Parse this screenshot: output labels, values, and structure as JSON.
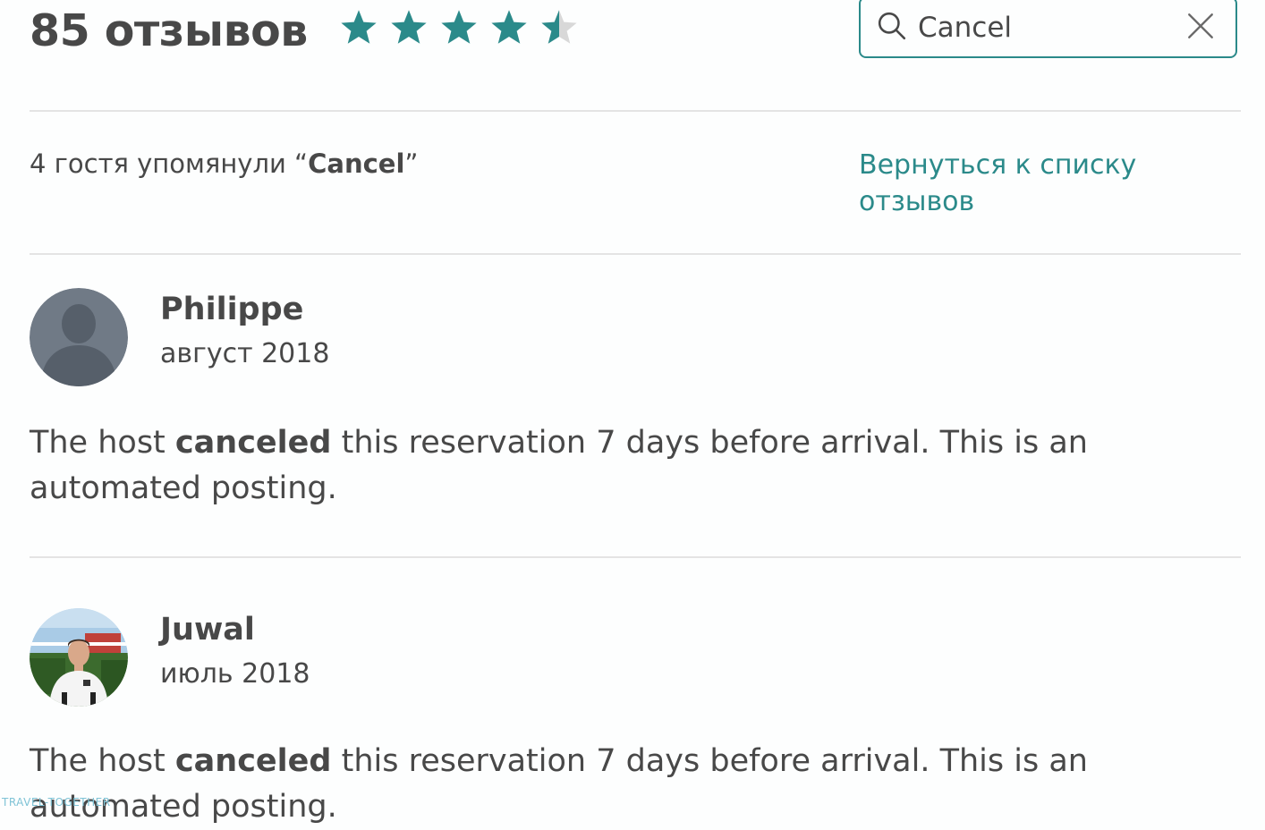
{
  "header": {
    "review_count": "85 отзывов",
    "rating": 4.5,
    "rating_max": 5,
    "star_color": "#2b8a8a",
    "star_empty_color": "#d8d8d8"
  },
  "search": {
    "value": "Cancel",
    "icon": "search-icon",
    "clear_icon": "close-icon",
    "border_color": "#2b8a8a"
  },
  "summary": {
    "prefix": "4 гостя упомянули “",
    "keyword": "Cancel",
    "suffix": "”"
  },
  "back_link": {
    "label": "Вернуться к списку отзывов",
    "color": "#2b8a8a"
  },
  "reviews": [
    {
      "name": "Philippe",
      "date": "август 2018",
      "avatar": "default-user-avatar",
      "text_before": "The host ",
      "text_highlight": "canceled",
      "text_after": " this reservation 7 days before arrival. This is an automated posting."
    },
    {
      "name": "Juwal",
      "date": "июль 2018",
      "avatar": "photo-avatar",
      "text_before": "The host ",
      "text_highlight": "canceled",
      "text_after": " this reservation 7 days before arrival. This is an automated posting."
    }
  ],
  "watermark": "TRAVEL-TOGETHER"
}
